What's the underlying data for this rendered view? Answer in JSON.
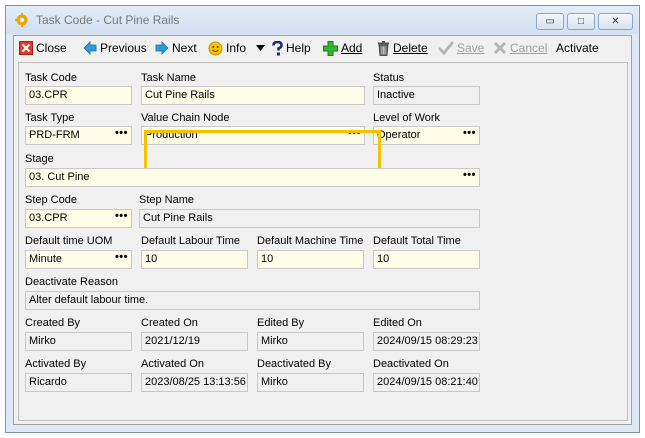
{
  "window": {
    "title": "Task Code - Cut Pine Rails",
    "controls": [
      "▭",
      "□",
      "✕"
    ]
  },
  "toolbar": {
    "close": "Close",
    "previous": "Previous",
    "next": "Next",
    "info": "Info",
    "help": "Help",
    "add": "Add",
    "delete": "Delete",
    "save": "Save",
    "cancel": "Cancel",
    "activate": "Activate"
  },
  "form": {
    "task_code": {
      "label": "Task Code",
      "value": "03.CPR"
    },
    "task_name": {
      "label": "Task Name",
      "value": "Cut Pine Rails"
    },
    "status": {
      "label": "Status",
      "value": "Inactive"
    },
    "task_type": {
      "label": "Task Type",
      "value": "PRD-FRM"
    },
    "value_chain_node": {
      "label": "Value Chain Node",
      "value": "Production"
    },
    "level_of_work": {
      "label": "Level of Work",
      "value": "Operator"
    },
    "stage": {
      "label": "Stage",
      "value": "03. Cut Pine"
    },
    "step_code": {
      "label": "Step Code",
      "value": "03.CPR"
    },
    "step_name": {
      "label": "Step Name",
      "value": "Cut Pine Rails"
    },
    "default_time_uom": {
      "label": "Default time UOM",
      "value": "Minute"
    },
    "default_labour_time": {
      "label": "Default Labour Time",
      "value": "10"
    },
    "default_machine_time": {
      "label": "Default Machine Time",
      "value": "10"
    },
    "default_total_time": {
      "label": "Default Total Time",
      "value": "10"
    },
    "deactivate_reason": {
      "label": "Deactivate Reason",
      "value": "Alter default labour time."
    },
    "created_by": {
      "label": "Created By",
      "value": "Mirko"
    },
    "created_on": {
      "label": "Created On",
      "value": "2021/12/19"
    },
    "edited_by": {
      "label": "Edited By",
      "value": "Mirko"
    },
    "edited_on": {
      "label": "Edited On",
      "value": "2024/09/15 08:29:23"
    },
    "activated_by": {
      "label": "Activated By",
      "value": "Ricardo"
    },
    "activated_on": {
      "label": "Activated On",
      "value": "2023/08/25 13:13:56"
    },
    "deactivated_by": {
      "label": "Deactivated By",
      "value": "Mirko"
    },
    "deactivated_on": {
      "label": "Deactivated On",
      "value": "2024/09/15 08:21:40"
    }
  },
  "lookup_button_text": "•••",
  "colors": {
    "highlight": "#f5c200",
    "editable_field": "#fffde7",
    "readonly_field": "#f0f0f0"
  }
}
